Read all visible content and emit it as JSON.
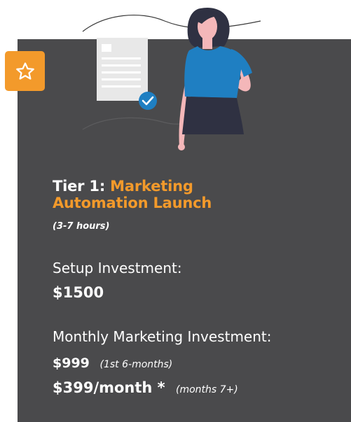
{
  "colors": {
    "card_background": "#4a4a4c",
    "accent": "#f39a2b",
    "text": "#ffffff",
    "figure_top": "#1f7fc2",
    "figure_skirt": "#2f3142",
    "check_badge": "#1f7fc2"
  },
  "badge": {
    "icon": "star-outline-icon"
  },
  "illustration": {
    "icons": [
      "document-icon",
      "checkmark-icon",
      "person-illustration"
    ]
  },
  "tier": {
    "prefix": "Tier 1:",
    "name": "Marketing Automation Launch",
    "duration": "(3-7 hours)"
  },
  "setup": {
    "label": "Setup Investment:",
    "price": "$1500"
  },
  "monthly": {
    "label": "Monthly Marketing Investment:",
    "price_1": "$999",
    "note_1": "(1st 6-months)",
    "price_2": "$399/month *",
    "note_2": "(months 7+)"
  }
}
